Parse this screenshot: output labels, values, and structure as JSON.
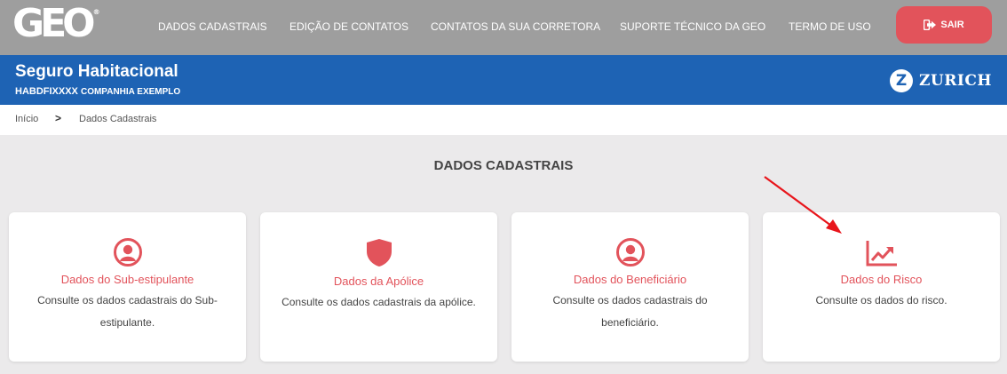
{
  "header": {
    "logo_text": "GEO",
    "logo_mark": "®",
    "nav": [
      {
        "label": "DADOS CADASTRAIS"
      },
      {
        "label": "EDIÇÃO DE CONTATOS"
      },
      {
        "label": "CONTATOS DA SUA CORRETORA"
      },
      {
        "label": "SUPORTE TÉCNICO DA GEO"
      },
      {
        "label": "TERMO DE USO"
      }
    ],
    "logout_label": "SAIR",
    "logout_icon": "sign-out-icon"
  },
  "product": {
    "title": "Seguro Habitacional",
    "policy_code": "HABDFIXXXX",
    "company": "COMPANHIA EXEMPLO",
    "insurer_logo": "Z",
    "insurer_name": "ZURICH"
  },
  "breadcrumb": {
    "home": "Início",
    "current": "Dados Cadastrais"
  },
  "section_title": "DADOS CADASTRAIS",
  "cards": [
    {
      "icon": "user-circle-icon",
      "title": "Dados do Sub-estipulante",
      "desc": "Consulte os dados cadastrais do Sub-estipulante."
    },
    {
      "icon": "shield-icon",
      "title": "Dados da Apólice",
      "desc": "Consulte os dados cadastrais da apólice."
    },
    {
      "icon": "user-circle-icon",
      "title": "Dados do Beneficiário",
      "desc": "Consulte os dados cadastrais do beneficiário."
    },
    {
      "icon": "line-chart-icon",
      "title": "Dados do Risco",
      "desc": "Consulte os dados do risco."
    }
  ],
  "colors": {
    "topbar": "#9e9e9e",
    "accent": "#e2535b",
    "brand_blue": "#1e63b4",
    "annotation_arrow": "#e8151b"
  }
}
